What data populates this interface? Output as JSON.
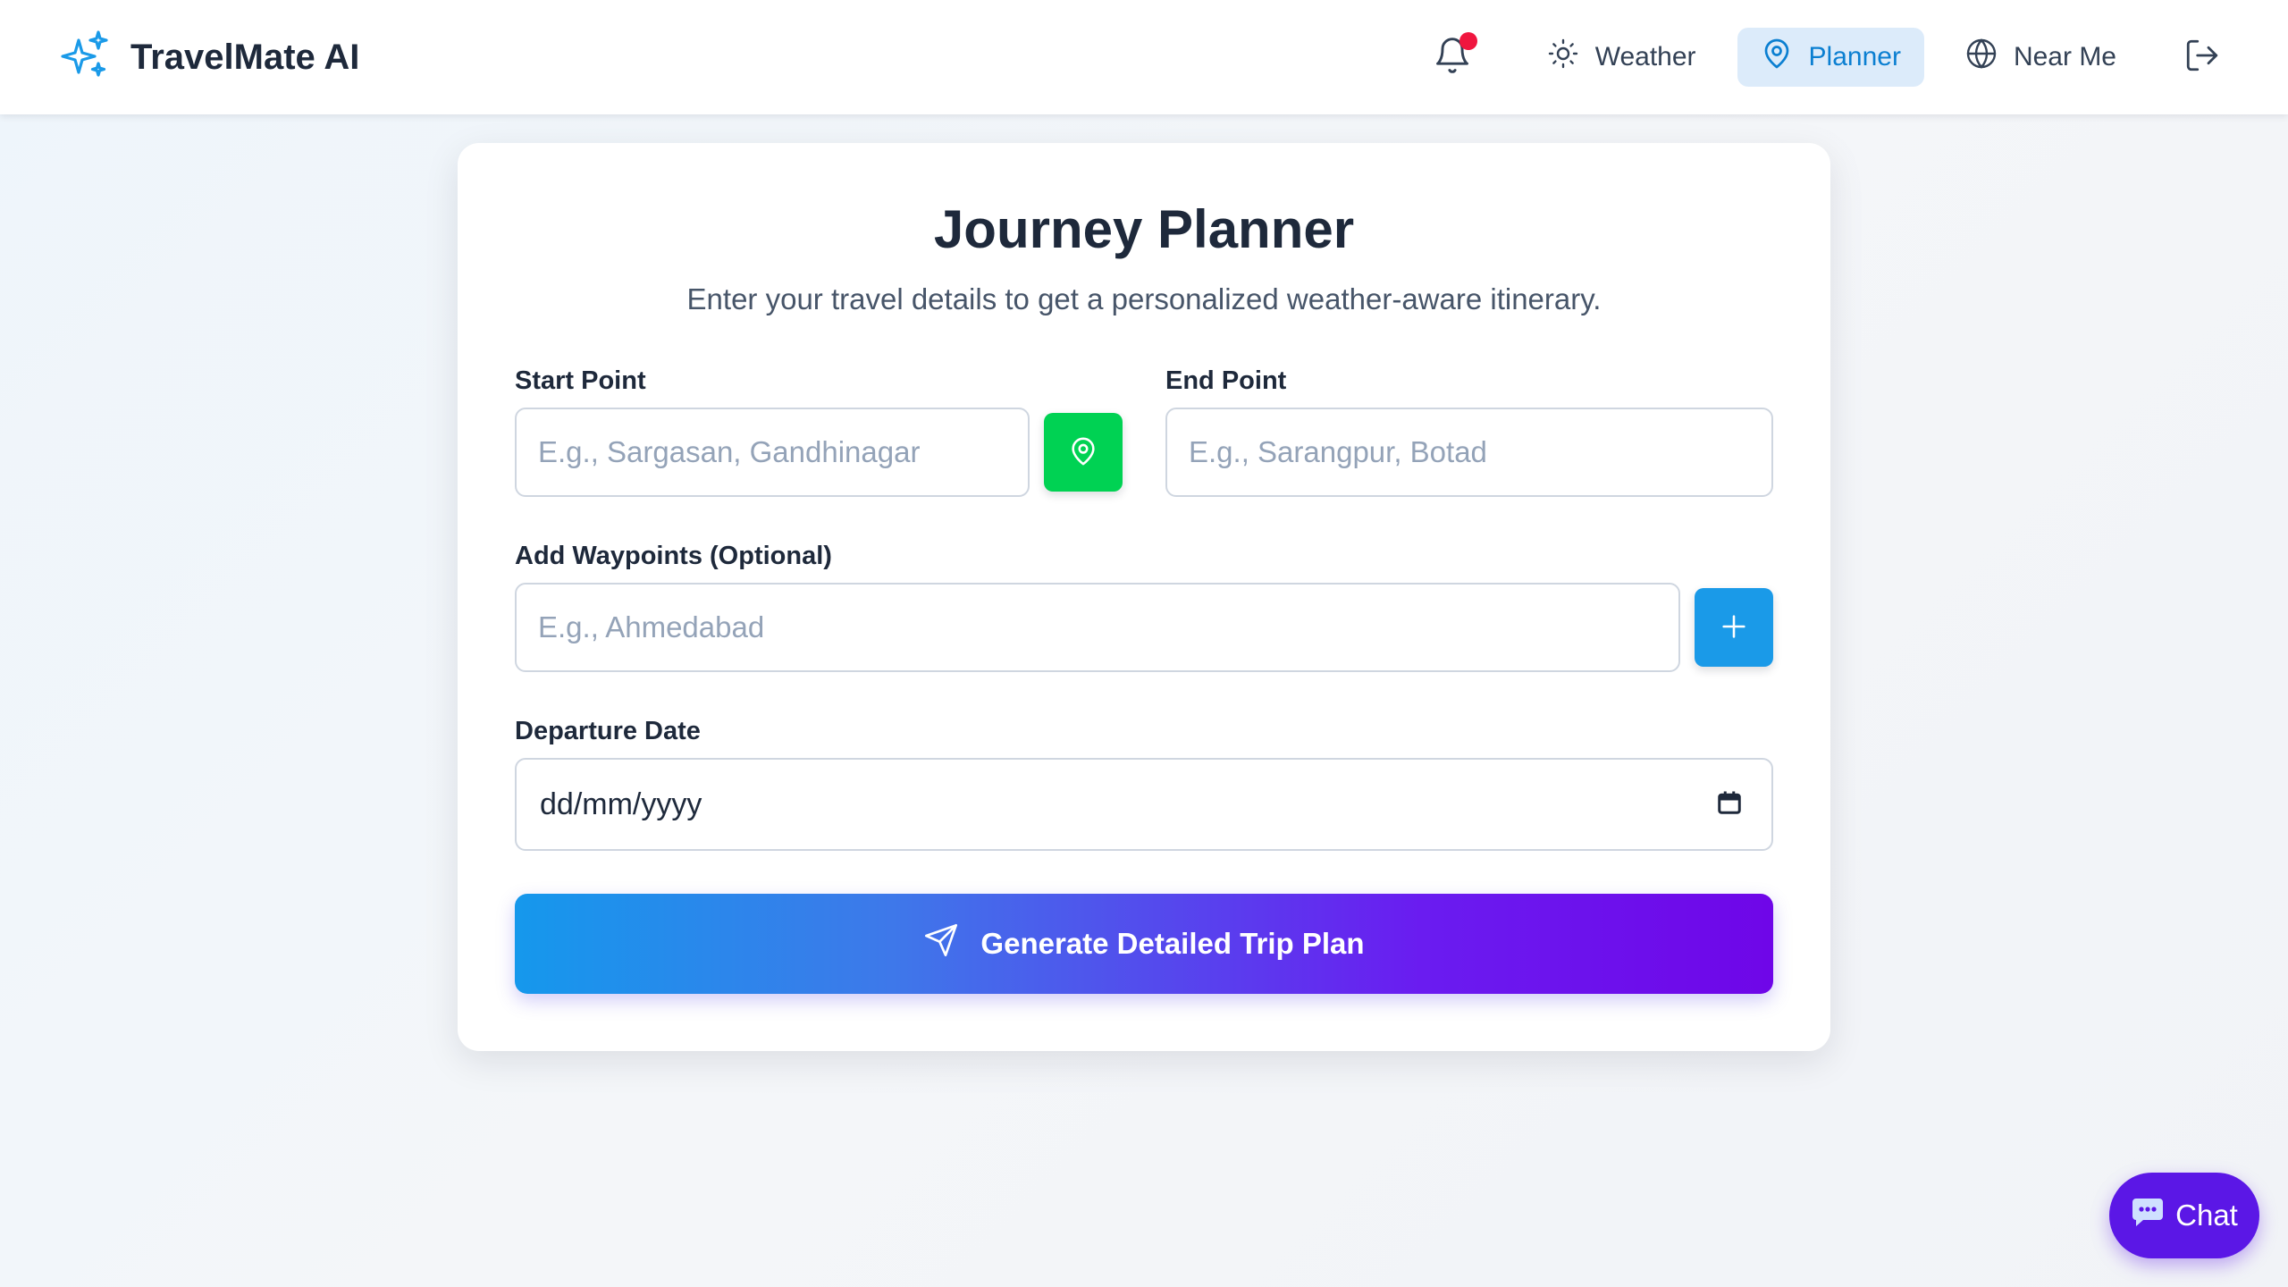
{
  "app": {
    "brand_name": "TravelMate AI",
    "brand_icon": "sparkles-icon"
  },
  "nav": {
    "notification_icon": "bell-icon",
    "items": [
      {
        "label": "Weather",
        "icon": "sun-icon",
        "active": false
      },
      {
        "label": "Planner",
        "icon": "map-pin-icon",
        "active": true
      },
      {
        "label": "Near Me",
        "icon": "globe-icon",
        "active": false
      }
    ],
    "logout_icon": "logout-icon"
  },
  "planner": {
    "title": "Journey Planner",
    "subtitle": "Enter your travel details to get a personalized weather-aware itinerary.",
    "start": {
      "label": "Start Point",
      "placeholder": "E.g., Sargasan, Gandhinagar",
      "value": ""
    },
    "end": {
      "label": "End Point",
      "placeholder": "E.g., Sarangpur, Botad",
      "value": ""
    },
    "waypoints": {
      "label": "Add Waypoints (Optional)",
      "placeholder": "E.g., Ahmedabad",
      "value": ""
    },
    "date": {
      "label": "Departure Date",
      "value": "dd/mm/yyyy"
    },
    "submit_label": "Generate Detailed Trip Plan"
  },
  "chat": {
    "label": "Chat",
    "icon": "chat-bubble-icon"
  },
  "colors": {
    "accent_blue": "#1a9ae8",
    "location_green": "#00d253",
    "chat_purple": "#5b17e6",
    "notification_red": "#f0163f"
  }
}
